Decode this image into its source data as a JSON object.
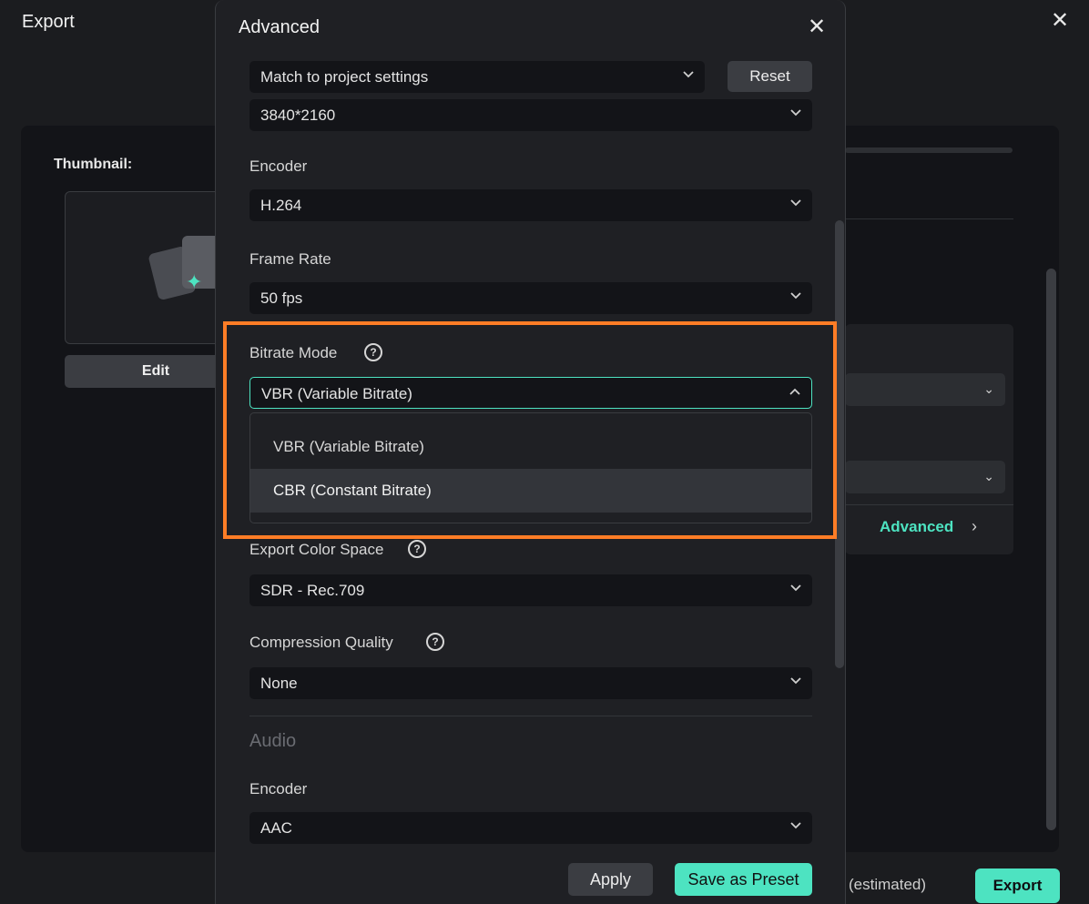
{
  "export_window": {
    "title": "Export",
    "thumbnail_label": "Thumbnail:",
    "edit_label": "Edit",
    "advanced_link": "Advanced",
    "estimated_text": "(estimated)",
    "export_button": "Export"
  },
  "modal": {
    "title": "Advanced",
    "preset_select": "Match to project settings",
    "reset_label": "Reset",
    "resolution": "3840*2160",
    "video": {
      "encoder_label": "Encoder",
      "encoder_value": "H.264",
      "frame_rate_label": "Frame Rate",
      "frame_rate_value": "50 fps",
      "bitrate_mode_label": "Bitrate Mode",
      "bitrate_mode_value": "VBR (Variable Bitrate)",
      "bitrate_options": [
        "VBR (Variable Bitrate)",
        "CBR (Constant Bitrate)"
      ],
      "color_space_label": "Export Color Space",
      "color_space_value": "SDR - Rec.709",
      "compression_label": "Compression Quality",
      "compression_value": "None"
    },
    "audio": {
      "section_label": "Audio",
      "encoder_label": "Encoder",
      "encoder_value": "AAC"
    },
    "apply_label": "Apply",
    "save_preset_label": "Save as Preset"
  },
  "colors": {
    "accent": "#4de3c1",
    "highlight": "#ff7d26",
    "modal_bg": "#1f2024",
    "input_bg": "#131418"
  }
}
